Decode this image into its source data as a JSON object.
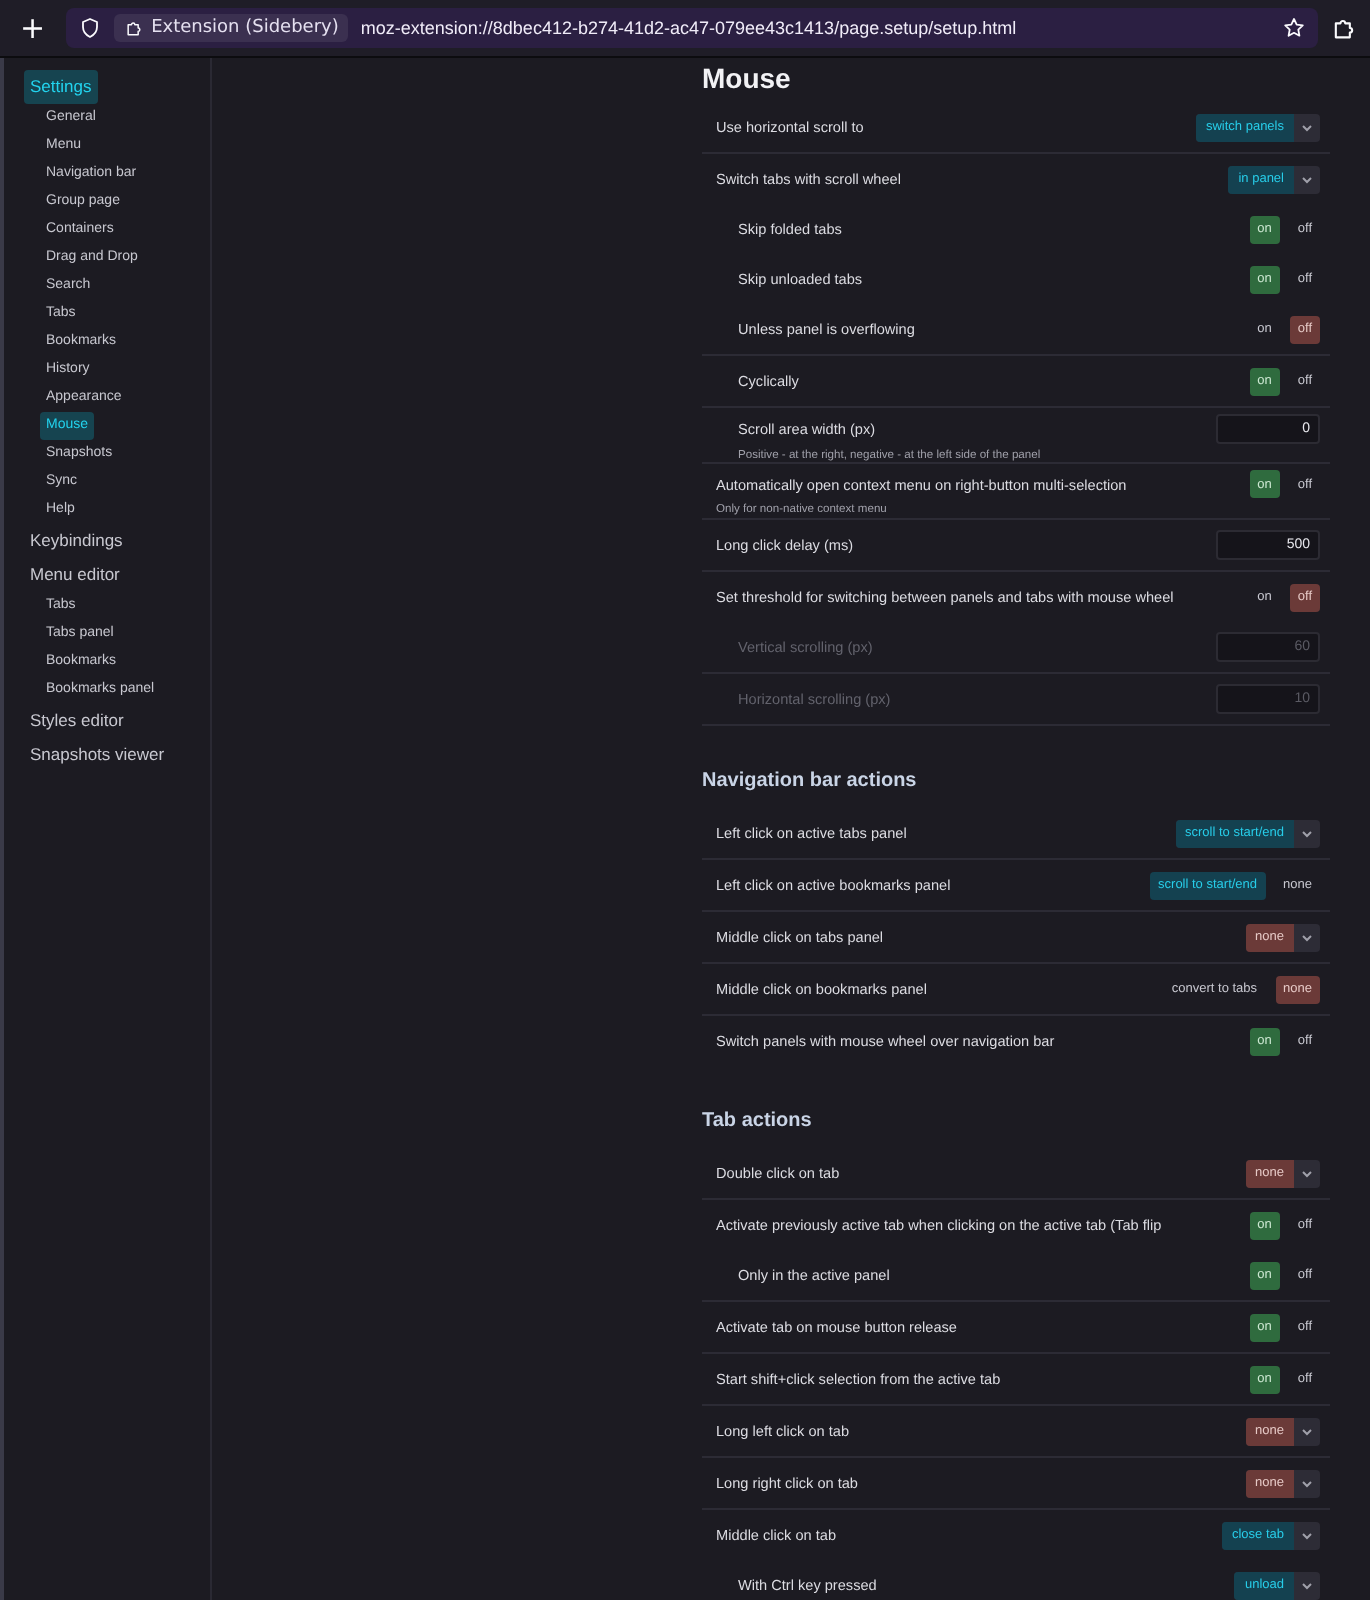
{
  "browser": {
    "new_tab": "+",
    "identity": "Extension (Sidebery)",
    "url": "moz-extension://8dbec412-b274-41d2-ac47-079ee43c1413/page.setup/setup.html"
  },
  "sidebar": [
    {
      "label": "Settings",
      "selected": true,
      "children": [
        {
          "label": "General",
          "selected": false
        },
        {
          "label": "Menu",
          "selected": false
        },
        {
          "label": "Navigation bar",
          "selected": false
        },
        {
          "label": "Group page",
          "selected": false
        },
        {
          "label": "Containers",
          "selected": false
        },
        {
          "label": "Drag and Drop",
          "selected": false
        },
        {
          "label": "Search",
          "selected": false
        },
        {
          "label": "Tabs",
          "selected": false
        },
        {
          "label": "Bookmarks",
          "selected": false
        },
        {
          "label": "History",
          "selected": false
        },
        {
          "label": "Appearance",
          "selected": false
        },
        {
          "label": "Mouse",
          "selected": true
        },
        {
          "label": "Snapshots",
          "selected": false
        },
        {
          "label": "Sync",
          "selected": false
        },
        {
          "label": "Help",
          "selected": false
        }
      ]
    },
    {
      "label": "Keybindings",
      "selected": false
    },
    {
      "label": "Menu editor",
      "selected": false,
      "children": [
        {
          "label": "Tabs",
          "selected": false
        },
        {
          "label": "Tabs panel",
          "selected": false
        },
        {
          "label": "Bookmarks",
          "selected": false
        },
        {
          "label": "Bookmarks panel",
          "selected": false
        }
      ]
    },
    {
      "label": "Styles editor",
      "selected": false
    },
    {
      "label": "Snapshots viewer",
      "selected": false
    }
  ],
  "sections": [
    {
      "kind": "page",
      "title": "Mouse",
      "rows": [
        {
          "kind": "select",
          "label": "Use horizontal scroll to",
          "value": "switch panels",
          "color": "#144150"
        },
        {
          "kind": "select",
          "label": "Switch tabs with scroll wheel",
          "value": "in panel",
          "color": "#144150",
          "children": [
            {
              "kind": "toggle",
              "label": "Skip folded tabs",
              "on": true,
              "on_label": "on",
              "off_label": "off"
            },
            {
              "kind": "toggle",
              "label": "Skip unloaded tabs",
              "on": true,
              "on_label": "on",
              "off_label": "off"
            },
            {
              "kind": "toggle",
              "label": "Unless panel is overflowing",
              "on": false,
              "on_label": "on",
              "off_label": "off"
            },
            {
              "kind": "toggle",
              "label": "Cyclically",
              "on": true,
              "on_label": "on",
              "off_label": "off"
            },
            {
              "kind": "number",
              "label": "Scroll area width (px)",
              "value": "0",
              "disabled": false,
              "hint": "Positive - at the right, negative - at the left side of the panel"
            }
          ]
        },
        {
          "kind": "toggle",
          "label": "Automatically open context menu on right-button multi-selection",
          "on": true,
          "on_label": "on",
          "off_label": "off",
          "hint": "Only for non-native context menu"
        },
        {
          "kind": "number",
          "label": "Long click delay (ms)",
          "value": "500",
          "disabled": false
        },
        {
          "kind": "toggle",
          "label": "Set threshold for switching between panels and tabs with mouse wheel",
          "on": false,
          "on_label": "on",
          "off_label": "off",
          "children": [
            {
              "kind": "number",
              "label": "Vertical scrolling (px)",
              "value": "60",
              "disabled": true
            },
            {
              "kind": "number",
              "label": "Horizontal scrolling (px)",
              "value": "10",
              "disabled": true
            }
          ]
        }
      ]
    },
    {
      "kind": "group",
      "title": "Navigation bar actions",
      "rows": [
        {
          "kind": "select",
          "label": "Left click on active tabs panel",
          "value": "scroll to start/end",
          "color": "#144150"
        },
        {
          "kind": "choice",
          "label": "Left click on active bookmarks panel",
          "color": "#144150",
          "options": [
            {
              "label": "scroll to start/end",
              "selected": true
            },
            {
              "label": "none",
              "selected": false
            }
          ]
        },
        {
          "kind": "select",
          "label": "Middle click on tabs panel",
          "value": "none",
          "color": "#6b3a38"
        },
        {
          "kind": "choice",
          "label": "Middle click on bookmarks panel",
          "color": "#6b3a38",
          "options": [
            {
              "label": "convert to tabs",
              "selected": false
            },
            {
              "label": "none",
              "selected": true
            }
          ]
        },
        {
          "kind": "toggle",
          "label": "Switch panels with mouse wheel over navigation bar",
          "on": true,
          "on_label": "on",
          "off_label": "off"
        }
      ]
    },
    {
      "kind": "group",
      "title": "Tab actions",
      "rows": [
        {
          "kind": "select",
          "label": "Double click on tab",
          "value": "none",
          "color": "#6b3a38"
        },
        {
          "kind": "toggle",
          "label": "Activate previously active tab when clicking on the active tab (Tab flip",
          "on": true,
          "on_label": "on",
          "off_label": "off",
          "children": [
            {
              "kind": "toggle",
              "label": "Only in the active panel",
              "on": true,
              "on_label": "on",
              "off_label": "off"
            }
          ]
        },
        {
          "kind": "toggle",
          "label": "Activate tab on mouse button release",
          "on": true,
          "on_label": "on",
          "off_label": "off"
        },
        {
          "kind": "toggle",
          "label": "Start shift+click selection from the active tab",
          "on": true,
          "on_label": "on",
          "off_label": "off"
        },
        {
          "kind": "select",
          "label": "Long left click on tab",
          "value": "none",
          "color": "#6b3a38"
        },
        {
          "kind": "select",
          "label": "Long right click on tab",
          "value": "none",
          "color": "#6b3a38"
        },
        {
          "kind": "select",
          "label": "Middle click on tab",
          "value": "close tab",
          "color": "#144150",
          "children": [
            {
              "kind": "select",
              "label": "With Ctrl key pressed",
              "value": "unload",
              "color": "#144150"
            }
          ]
        }
      ]
    }
  ]
}
